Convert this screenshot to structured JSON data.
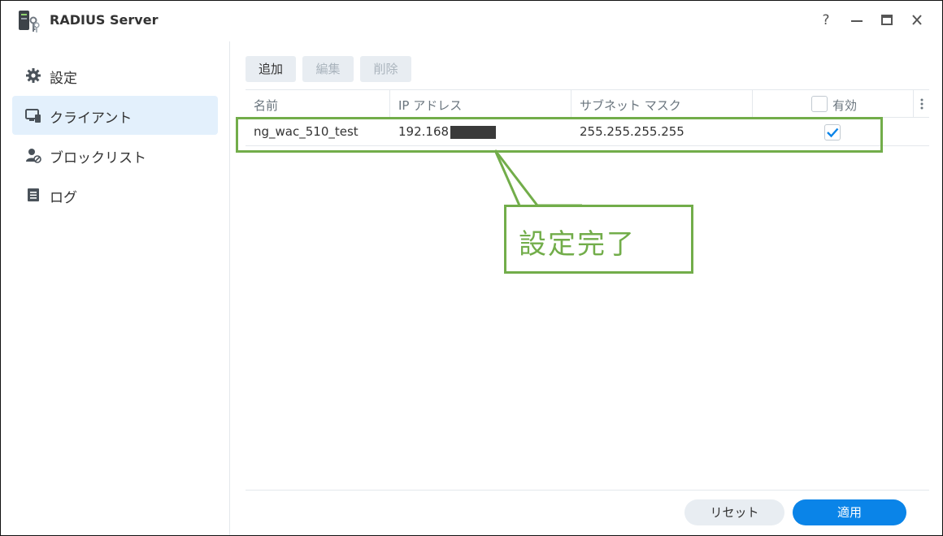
{
  "window": {
    "title": "RADIUS Server",
    "controls": {
      "help": "?",
      "minimize": "—",
      "maximize": "▭",
      "close": "✕"
    }
  },
  "sidebar": {
    "items": [
      {
        "label": "設定",
        "icon": "gear-icon",
        "active": false
      },
      {
        "label": "クライアント",
        "icon": "client-icon",
        "active": true
      },
      {
        "label": "ブロックリスト",
        "icon": "user-block-icon",
        "active": false
      },
      {
        "label": "ログ",
        "icon": "log-icon",
        "active": false
      }
    ]
  },
  "toolbar": {
    "add_label": "追加",
    "edit_label": "編集",
    "delete_label": "削除"
  },
  "table": {
    "columns": {
      "name": "名前",
      "ip": "IP アドレス",
      "subnet": "サブネット マスク",
      "enabled": "有効"
    },
    "rows": [
      {
        "name": "ng_wac_510_test",
        "ip": "192.168",
        "subnet": "255.255.255.255",
        "enabled": true
      }
    ]
  },
  "annotation": {
    "text": "設定完了",
    "color": "#72ad4a"
  },
  "footer": {
    "reset_label": "リセット",
    "apply_label": "適用"
  },
  "colors": {
    "accent": "#0a84e8",
    "active_bg": "#e3f0fc"
  }
}
